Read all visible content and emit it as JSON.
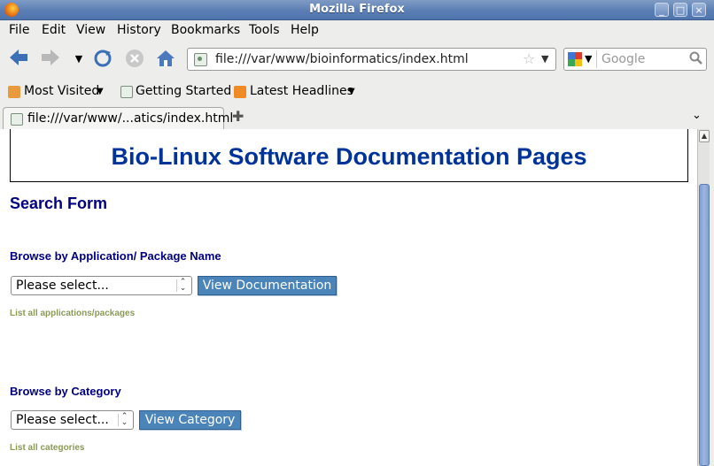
{
  "window": {
    "title": "Mozilla Firefox",
    "controls": {
      "minimize": "_",
      "maximize": "□",
      "close": "×"
    }
  },
  "menu": {
    "items": [
      "File",
      "Edit",
      "View",
      "History",
      "Bookmarks",
      "Tools",
      "Help"
    ]
  },
  "navigation": {
    "url": "file:///var/www/bioinformatics/index.html",
    "search_placeholder": "Google"
  },
  "bookmarks": {
    "items": [
      "Most Visited",
      "Getting Started",
      "Latest Headlines"
    ]
  },
  "tabs": [
    {
      "label": "file:///var/www/...atics/index.html"
    }
  ],
  "page": {
    "banner_title": "Bio-Linux Software Documentation Pages",
    "search_heading": "Search Form",
    "app_section": {
      "heading": "Browse by Application/ Package Name",
      "select_value": "Please select...",
      "button_label": "View Documentation",
      "list_link": "List all applications/packages"
    },
    "category_section": {
      "heading": "Browse by Category",
      "select_value": "Please select...",
      "button_label": "View Category",
      "list_link": "List all categories"
    }
  },
  "colors": {
    "banner_title": "#003399",
    "heading": "#000080",
    "button": "#4a84b9",
    "small_link": "#8a9a58",
    "titlebar": "#5a7eb4"
  }
}
